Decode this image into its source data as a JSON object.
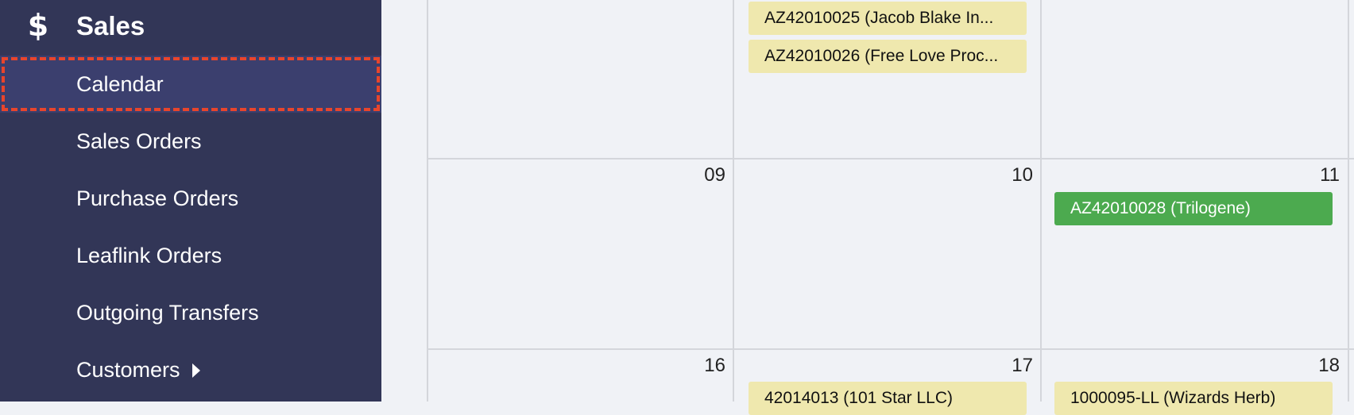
{
  "sidebar": {
    "section_icon": "dollar-icon",
    "section_title": "Sales",
    "items": [
      {
        "label": "Calendar",
        "active": true
      },
      {
        "label": "Sales Orders"
      },
      {
        "label": "Purchase Orders"
      },
      {
        "label": "Leaflink Orders"
      },
      {
        "label": "Outgoing Transfers"
      },
      {
        "label": "Customers",
        "has_submenu": true
      }
    ]
  },
  "calendar": {
    "days": [
      "09",
      "10",
      "11",
      "16",
      "17",
      "18"
    ],
    "events": [
      {
        "label": "AZ42010025 (Jacob Blake In...",
        "color": "#efe8ae"
      },
      {
        "label": "AZ42010026 (Free Love Proc...",
        "color": "#efe8ae"
      },
      {
        "label": "AZ42010028 (Trilogene)",
        "color": "#4caa4f"
      },
      {
        "label": "42014013 (101 Star LLC)",
        "color": "#efe8ae"
      },
      {
        "label": "1000095-LL (Wizards Herb)",
        "color": "#efe8ae"
      }
    ]
  },
  "colors": {
    "sidebar_bg": "#323657",
    "active_bg": "#3b3f6e",
    "highlight_outline": "#e8452c",
    "calendar_bg": "#f0f2f6"
  }
}
